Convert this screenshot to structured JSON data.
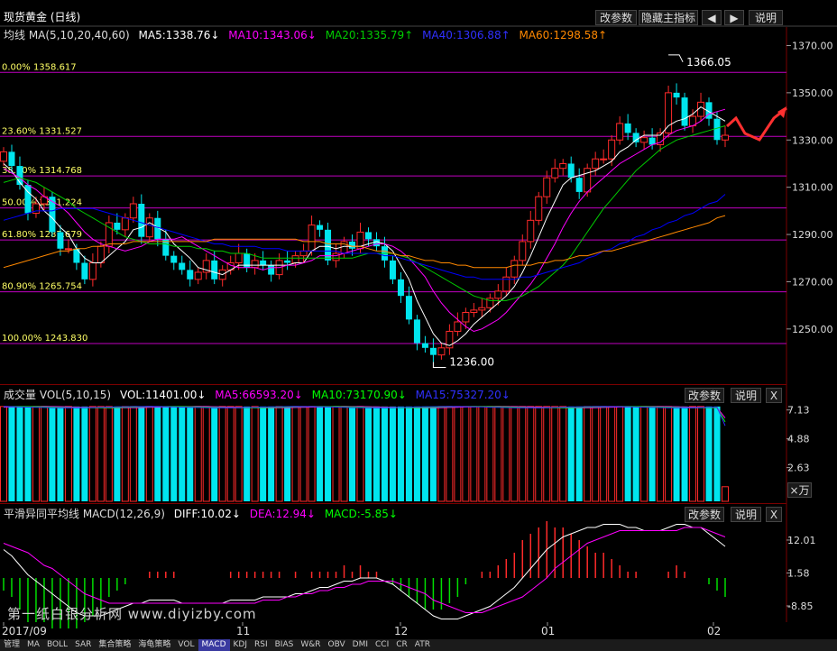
{
  "title": "现货黄金 (日线)",
  "top_buttons": {
    "params": "改参数",
    "hide": "隐藏主指标",
    "prev": "◀",
    "next": "▶",
    "help": "说明"
  },
  "ma_header": {
    "label": "均线 MA(5,10,20,40,60)",
    "ma5": "MA5:1338.76↓",
    "ma10": "MA10:1343.06↓",
    "ma20": "MA20:1335.79↑",
    "ma40": "MA40:1306.88↑",
    "ma60": "MA60:1298.58↑"
  },
  "vol_header": {
    "label": "成交量 VOL(5,10,15)",
    "vol": "VOL:11401.00↓",
    "ma5": "MA5:66593.20↓",
    "ma10": "MA10:73170.90↓",
    "ma15": "MA15:75327.20↓"
  },
  "macd_header": {
    "label": "平滑异同平均线 MACD(12,26,9)",
    "diff": "DIFF:10.02↓",
    "dea": "DEA:12.94↓",
    "macd": "MACD:-5.85↓"
  },
  "sub_buttons": {
    "params": "改参数",
    "help": "说明",
    "close": "X"
  },
  "vol_unit": "×万",
  "watermark": "第一纸白银分析网 www.diyizby.com",
  "colors": {
    "up": "#ff2a2a",
    "down": "#00e5ee",
    "ma5": "#ffffff",
    "ma10": "#ff00ff",
    "ma20": "#00cc00",
    "ma40": "#0000ff",
    "ma60": "#ff8800",
    "fib": "#c000c0",
    "grid": "#7a0000"
  },
  "tabs": [
    "管理",
    "MA",
    "BOLL",
    "SAR",
    "集合策略",
    "海龟策略",
    "VOL",
    "MACD",
    "KDJ",
    "RSI",
    "BIAS",
    "W&R",
    "OBV",
    "DMI",
    "CCI",
    "CR",
    "ATR"
  ],
  "active_tab": "MACD",
  "chart_data": [
    {
      "type": "candlestick",
      "title": "现货黄金 (日线)",
      "x_ticks": [
        "2017/09",
        "11",
        "12",
        "01",
        "02"
      ],
      "price_axis": [
        1250,
        1270,
        1290,
        1310,
        1330,
        1350,
        1370
      ],
      "y_axis_labels": [
        "1250.00",
        "1270.00",
        "1290.00",
        "1310.00",
        "1330.00",
        "1350.00",
        "1370.00"
      ],
      "ylim": [
        1232,
        1374
      ],
      "annotations": {
        "high": "1366.05",
        "low": "1236.00"
      },
      "fibonacci": [
        {
          "label": "0.00% 1358.617",
          "value": 1358.617
        },
        {
          "label": "23.60% 1331.527",
          "value": 1331.527
        },
        {
          "label": "38.20% 1314.768",
          "value": 1314.768
        },
        {
          "label": "50.00% 1301.224",
          "value": 1301.224
        },
        {
          "label": "61.80% 1287.679",
          "value": 1287.679
        },
        {
          "label": "80.90% 1265.754",
          "value": 1265.754
        },
        {
          "label": "100.00% 1243.830",
          "value": 1243.83
        }
      ],
      "closes": [
        1325,
        1319,
        1311,
        1299,
        1303,
        1306,
        1291,
        1284,
        1284,
        1278,
        1271,
        1278,
        1285,
        1295,
        1292,
        1297,
        1303,
        1289,
        1297,
        1288,
        1281,
        1278,
        1275,
        1271,
        1274,
        1279,
        1271,
        1275,
        1278,
        1282,
        1276,
        1279,
        1277,
        1273,
        1279,
        1278,
        1281,
        1283,
        1294,
        1292,
        1279,
        1282,
        1287,
        1284,
        1291,
        1288,
        1285,
        1279,
        1271,
        1264,
        1254,
        1244,
        1242,
        1239,
        1242,
        1249,
        1253,
        1257,
        1258,
        1259,
        1263,
        1266,
        1272,
        1279,
        1287,
        1296,
        1306,
        1314,
        1318,
        1320,
        1314,
        1308,
        1318,
        1322,
        1322,
        1330,
        1337,
        1333,
        1329,
        1331,
        1328,
        1333,
        1350,
        1348,
        1336,
        1340,
        1346,
        1339,
        1330,
        1332
      ],
      "ma_series": {
        "MA5": [
          1320,
          1317,
          1312,
          1308,
          1305,
          1300,
          1297,
          1293,
          1290,
          1284,
          1280,
          1278,
          1278,
          1281,
          1284,
          1287,
          1292,
          1293,
          1295,
          1293,
          1291,
          1286,
          1283,
          1280,
          1276,
          1275,
          1274,
          1273,
          1275,
          1277,
          1277,
          1277,
          1277,
          1277,
          1277,
          1277,
          1278,
          1278,
          1283,
          1285,
          1285,
          1284,
          1285,
          1285,
          1285,
          1286,
          1287,
          1286,
          1283,
          1277,
          1271,
          1262,
          1255,
          1248,
          1244,
          1243,
          1245,
          1248,
          1252,
          1255,
          1258,
          1261,
          1264,
          1268,
          1274,
          1281,
          1289,
          1297,
          1304,
          1311,
          1314,
          1315,
          1316,
          1317,
          1319,
          1321,
          1325,
          1327,
          1330,
          1332,
          1332,
          1332,
          1336,
          1338,
          1339,
          1341,
          1344,
          1342,
          1340,
          1338
        ],
        "MA10": [
          1318,
          1316,
          1314,
          1311,
          1309,
          1306,
          1304,
          1302,
          1299,
          1295,
          1291,
          1288,
          1286,
          1285,
          1284,
          1283,
          1284,
          1285,
          1287,
          1288,
          1288,
          1288,
          1289,
          1287,
          1285,
          1283,
          1281,
          1279,
          1277,
          1276,
          1276,
          1276,
          1275,
          1276,
          1276,
          1277,
          1277,
          1278,
          1279,
          1281,
          1281,
          1281,
          1282,
          1283,
          1284,
          1285,
          1286,
          1286,
          1285,
          1283,
          1280,
          1276,
          1272,
          1266,
          1261,
          1257,
          1254,
          1251,
          1249,
          1250,
          1252,
          1254,
          1257,
          1261,
          1265,
          1269,
          1274,
          1280,
          1286,
          1293,
          1299,
          1304,
          1308,
          1311,
          1314,
          1317,
          1320,
          1322,
          1324,
          1326,
          1328,
          1329,
          1332,
          1334,
          1335,
          1336,
          1338,
          1341,
          1342,
          1343
        ],
        "MA20": [
          1312,
          1313,
          1314,
          1313,
          1312,
          1310,
          1308,
          1306,
          1304,
          1301,
          1299,
          1297,
          1295,
          1293,
          1291,
          1289,
          1288,
          1287,
          1286,
          1286,
          1286,
          1285,
          1285,
          1285,
          1284,
          1284,
          1283,
          1283,
          1282,
          1282,
          1282,
          1281,
          1280,
          1280,
          1280,
          1280,
          1280,
          1280,
          1280,
          1280,
          1280,
          1280,
          1280,
          1280,
          1281,
          1282,
          1282,
          1282,
          1282,
          1281,
          1280,
          1278,
          1276,
          1274,
          1272,
          1270,
          1268,
          1266,
          1264,
          1263,
          1262,
          1262,
          1262,
          1263,
          1264,
          1266,
          1268,
          1271,
          1274,
          1277,
          1281,
          1286,
          1291,
          1296,
          1301,
          1305,
          1309,
          1313,
          1317,
          1320,
          1323,
          1326,
          1328,
          1330,
          1331,
          1332,
          1333,
          1334,
          1335,
          1336
        ],
        "MA40": [
          1296,
          1297,
          1298,
          1299,
          1300,
          1300,
          1300,
          1301,
          1301,
          1301,
          1301,
          1301,
          1300,
          1299,
          1298,
          1297,
          1296,
          1295,
          1294,
          1293,
          1292,
          1291,
          1290,
          1289,
          1288,
          1287,
          1286,
          1286,
          1285,
          1285,
          1285,
          1285,
          1284,
          1284,
          1284,
          1283,
          1283,
          1283,
          1283,
          1283,
          1283,
          1283,
          1282,
          1282,
          1282,
          1282,
          1282,
          1281,
          1281,
          1280,
          1279,
          1278,
          1277,
          1276,
          1275,
          1274,
          1273,
          1272,
          1272,
          1271,
          1271,
          1271,
          1271,
          1271,
          1272,
          1272,
          1273,
          1274,
          1275,
          1276,
          1277,
          1278,
          1280,
          1281,
          1283,
          1284,
          1286,
          1287,
          1289,
          1290,
          1292,
          1293,
          1295,
          1296,
          1298,
          1299,
          1301,
          1303,
          1304,
          1307
        ],
        "MA60": [
          1276,
          1277,
          1278,
          1279,
          1280,
          1281,
          1282,
          1283,
          1283,
          1284,
          1284,
          1285,
          1285,
          1286,
          1286,
          1286,
          1287,
          1287,
          1287,
          1287,
          1287,
          1287,
          1287,
          1287,
          1287,
          1287,
          1288,
          1288,
          1288,
          1288,
          1288,
          1288,
          1288,
          1288,
          1288,
          1288,
          1288,
          1287,
          1287,
          1287,
          1286,
          1286,
          1286,
          1285,
          1285,
          1284,
          1283,
          1283,
          1282,
          1281,
          1281,
          1280,
          1279,
          1279,
          1278,
          1278,
          1277,
          1277,
          1276,
          1276,
          1276,
          1276,
          1276,
          1277,
          1277,
          1277,
          1278,
          1278,
          1279,
          1279,
          1280,
          1281,
          1281,
          1282,
          1283,
          1283,
          1284,
          1285,
          1286,
          1287,
          1288,
          1289,
          1290,
          1291,
          1292,
          1293,
          1294,
          1295,
          1297,
          1298
        ]
      }
    },
    {
      "type": "bar",
      "title": "成交量 VOL(5,10,15)",
      "y_axis_labels": [
        "7.13",
        "4.88",
        "2.63"
      ],
      "unit": "×万",
      "volumes": [
        7.4,
        7.4,
        7.4,
        7.4,
        7.4,
        7.4,
        7.4,
        7.4,
        7.4,
        7.4,
        7.4,
        7.4,
        7.4,
        7.4,
        7.4,
        7.4,
        7.4,
        7.4,
        7.4,
        7.4,
        7.4,
        7.4,
        7.4,
        7.4,
        7.4,
        7.4,
        7.4,
        7.4,
        7.4,
        7.4,
        7.4,
        7.4,
        7.4,
        7.4,
        7.4,
        7.4,
        7.4,
        7.4,
        7.4,
        7.4,
        7.4,
        7.4,
        7.4,
        7.4,
        7.4,
        7.4,
        7.4,
        7.4,
        7.4,
        7.4,
        7.4,
        7.4,
        7.4,
        7.4,
        7.4,
        7.4,
        7.4,
        7.4,
        7.4,
        7.4,
        7.4,
        7.4,
        7.4,
        7.4,
        7.4,
        7.4,
        7.4,
        7.4,
        7.4,
        7.4,
        7.4,
        7.4,
        7.4,
        7.4,
        7.4,
        7.4,
        7.4,
        7.4,
        7.4,
        7.4,
        7.4,
        7.4,
        7.4,
        7.4,
        7.4,
        7.4,
        7.4,
        7.4,
        7.4,
        1.14
      ]
    },
    {
      "type": "macd",
      "title": "平滑异同平均线 MACD(12,26,9)",
      "y_axis_labels": [
        "12.01",
        "1.58",
        "-8.85"
      ],
      "diff": [
        9,
        7,
        4,
        1,
        -1,
        -3,
        -5,
        -7,
        -9,
        -11,
        -12,
        -12,
        -12,
        -11,
        -10,
        -9,
        -8,
        -8,
        -7,
        -7,
        -7,
        -7,
        -8,
        -8,
        -8,
        -8,
        -8,
        -8,
        -7,
        -7,
        -7,
        -7,
        -6,
        -6,
        -6,
        -6,
        -5,
        -5,
        -4,
        -3,
        -3,
        -2,
        -1,
        -1,
        0,
        0,
        0,
        -1,
        -2,
        -4,
        -6,
        -8,
        -10,
        -12,
        -13,
        -13,
        -13,
        -12,
        -11,
        -10,
        -9,
        -7,
        -5,
        -3,
        0,
        3,
        6,
        9,
        11,
        13,
        14,
        15,
        16,
        16,
        17,
        17,
        17,
        16,
        16,
        15,
        15,
        15,
        16,
        17,
        17,
        16,
        16,
        14,
        12,
        10
      ],
      "dea": [
        11,
        10,
        9,
        8,
        6,
        4,
        3,
        1,
        -1,
        -3,
        -5,
        -6,
        -7,
        -8,
        -8,
        -8,
        -8,
        -8,
        -8,
        -8,
        -8,
        -8,
        -8,
        -8,
        -8,
        -8,
        -8,
        -8,
        -8,
        -8,
        -8,
        -8,
        -7,
        -7,
        -7,
        -6,
        -6,
        -5,
        -5,
        -4,
        -4,
        -3,
        -3,
        -2,
        -2,
        -1,
        -1,
        -1,
        -1,
        -2,
        -3,
        -4,
        -5,
        -7,
        -8,
        -9,
        -10,
        -11,
        -11,
        -11,
        -10,
        -9,
        -8,
        -7,
        -6,
        -4,
        -2,
        0,
        3,
        5,
        7,
        9,
        11,
        12,
        13,
        14,
        15,
        15,
        15,
        15,
        15,
        15,
        15,
        15,
        16,
        16,
        16,
        15,
        14,
        13
      ],
      "macd": [
        -4,
        -6,
        -10,
        -14,
        -14,
        -14,
        -16,
        -16,
        -16,
        -16,
        -14,
        -12,
        -10,
        -6,
        -4,
        -2,
        0,
        0,
        2,
        2,
        2,
        2,
        0,
        0,
        0,
        0,
        0,
        0,
        2,
        2,
        2,
        2,
        2,
        2,
        2,
        0,
        2,
        0,
        2,
        2,
        2,
        2,
        4,
        2,
        4,
        2,
        2,
        0,
        -2,
        -4,
        -6,
        -8,
        -10,
        -10,
        -10,
        -8,
        -6,
        -2,
        0,
        2,
        2,
        4,
        6,
        8,
        12,
        14,
        16,
        18,
        16,
        16,
        14,
        12,
        10,
        8,
        8,
        6,
        4,
        2,
        2,
        0,
        0,
        0,
        2,
        4,
        2,
        0,
        0,
        -2,
        -4,
        -6
      ]
    }
  ]
}
